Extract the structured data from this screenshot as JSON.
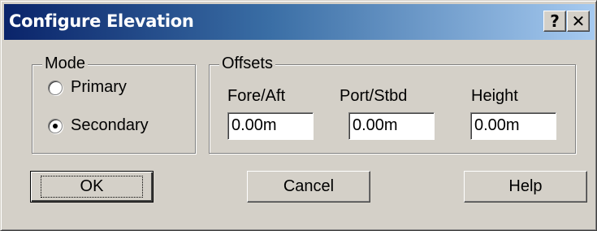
{
  "window": {
    "title": "Configure Elevation",
    "help_glyph": "?",
    "close_glyph": "✕"
  },
  "mode": {
    "legend": "Mode",
    "options": [
      {
        "label": "Primary",
        "selected": false
      },
      {
        "label": "Secondary",
        "selected": true
      }
    ]
  },
  "offsets": {
    "legend": "Offsets",
    "fields": [
      {
        "label": "Fore/Aft",
        "value": "0.00m"
      },
      {
        "label": "Port/Stbd",
        "value": "0.00m"
      },
      {
        "label": "Height",
        "value": "0.00m"
      }
    ]
  },
  "buttons": {
    "ok": "OK",
    "cancel": "Cancel",
    "help": "Help"
  },
  "colors": {
    "titlebar_start": "#0a246a",
    "titlebar_end": "#a6caf0",
    "face": "#d4d0c8"
  }
}
